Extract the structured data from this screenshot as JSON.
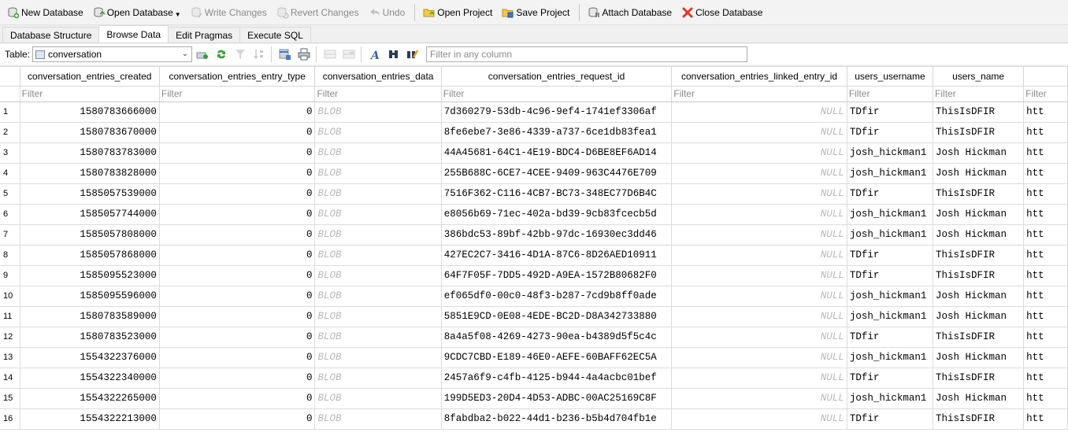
{
  "toolbar": {
    "new_database": "New Database",
    "open_database": "Open Database",
    "write_changes": "Write Changes",
    "revert_changes": "Revert Changes",
    "undo": "Undo",
    "open_project": "Open Project",
    "save_project": "Save Project",
    "attach_database": "Attach Database",
    "close_database": "Close Database"
  },
  "tabs": [
    "Database Structure",
    "Browse Data",
    "Edit Pragmas",
    "Execute SQL"
  ],
  "tablebar": {
    "table_label": "Table:",
    "table_value": "conversation",
    "filter_placeholder": "Filter in any column"
  },
  "grid": {
    "columns": [
      "conversation_entries_created",
      "conversation_entries_entry_type",
      "conversation_entries_data",
      "conversation_entries_request_id",
      "conversation_entries_linked_entry_id",
      "users_username",
      "users_name",
      ""
    ],
    "filter_placeholder": "Filter",
    "blob_label": "BLOB",
    "null_label": "NULL",
    "rows": [
      {
        "n": "1",
        "created": "1580783666000",
        "type": "0",
        "req": "7d360279-53db-4c96-9ef4-1741ef3306af",
        "user": "TDfir",
        "name": "ThisIsDFIR",
        "extra": "htt"
      },
      {
        "n": "2",
        "created": "1580783670000",
        "type": "0",
        "req": "8fe6ebe7-3e86-4339-a737-6ce1db83fea1",
        "user": "TDfir",
        "name": "ThisIsDFIR",
        "extra": "htt"
      },
      {
        "n": "3",
        "created": "1580783783000",
        "type": "0",
        "req": "44A45681-64C1-4E19-BDC4-D6BE8EF6AD14",
        "user": "josh_hickman1",
        "name": "Josh Hickman",
        "extra": "htt"
      },
      {
        "n": "4",
        "created": "1580783828000",
        "type": "0",
        "req": "255B688C-6CE7-4CEE-9409-963C4476E709",
        "user": "josh_hickman1",
        "name": "Josh Hickman",
        "extra": "htt"
      },
      {
        "n": "5",
        "created": "1585057539000",
        "type": "0",
        "req": "7516F362-C116-4CB7-BC73-348EC77D6B4C",
        "user": "TDfir",
        "name": "ThisIsDFIR",
        "extra": "htt"
      },
      {
        "n": "6",
        "created": "1585057744000",
        "type": "0",
        "req": "e8056b69-71ec-402a-bd39-9cb83fcecb5d",
        "user": "josh_hickman1",
        "name": "Josh Hickman",
        "extra": "htt"
      },
      {
        "n": "7",
        "created": "1585057808000",
        "type": "0",
        "req": "386bdc53-89bf-42bb-97dc-16930ec3dd46",
        "user": "josh_hickman1",
        "name": "Josh Hickman",
        "extra": "htt"
      },
      {
        "n": "8",
        "created": "1585057868000",
        "type": "0",
        "req": "427EC2C7-3416-4D1A-87C6-8D26AED10911",
        "user": "TDfir",
        "name": "ThisIsDFIR",
        "extra": "htt"
      },
      {
        "n": "9",
        "created": "1585095523000",
        "type": "0",
        "req": "64F7F05F-7DD5-492D-A9EA-1572B80682F0",
        "user": "TDfir",
        "name": "ThisIsDFIR",
        "extra": "htt"
      },
      {
        "n": "10",
        "created": "1585095596000",
        "type": "0",
        "req": "ef065df0-00c0-48f3-b287-7cd9b8ff0ade",
        "user": "josh_hickman1",
        "name": "Josh Hickman",
        "extra": "htt"
      },
      {
        "n": "11",
        "created": "1580783589000",
        "type": "0",
        "req": "5851E9CD-0E08-4EDE-BC2D-D8A342733880",
        "user": "josh_hickman1",
        "name": "Josh Hickman",
        "extra": "htt"
      },
      {
        "n": "12",
        "created": "1580783523000",
        "type": "0",
        "req": "8a4a5f08-4269-4273-90ea-b4389d5f5c4c",
        "user": "TDfir",
        "name": "ThisIsDFIR",
        "extra": "htt"
      },
      {
        "n": "13",
        "created": "1554322376000",
        "type": "0",
        "req": "9CDC7CBD-E189-46E0-AEFE-60BAFF62EC5A",
        "user": "josh_hickman1",
        "name": "Josh Hickman",
        "extra": "htt"
      },
      {
        "n": "14",
        "created": "1554322340000",
        "type": "0",
        "req": "2457a6f9-c4fb-4125-b944-4a4acbc01bef",
        "user": "TDfir",
        "name": "ThisIsDFIR",
        "extra": "htt"
      },
      {
        "n": "15",
        "created": "1554322265000",
        "type": "0",
        "req": "199D5ED3-20D4-4D53-ADBC-00AC25169C8F",
        "user": "josh_hickman1",
        "name": "Josh Hickman",
        "extra": "htt"
      },
      {
        "n": "16",
        "created": "1554322213000",
        "type": "0",
        "req": "8fabdba2-b022-44d1-b236-b5b4d704fb1e",
        "user": "TDfir",
        "name": "ThisIsDFIR",
        "extra": "htt"
      }
    ]
  },
  "colors": {
    "placeholder": "#8a8a8a",
    "blob_null_text": "#b8b8b8",
    "grid_line": "#dcdcdc",
    "close_red": "#d83a2a"
  }
}
